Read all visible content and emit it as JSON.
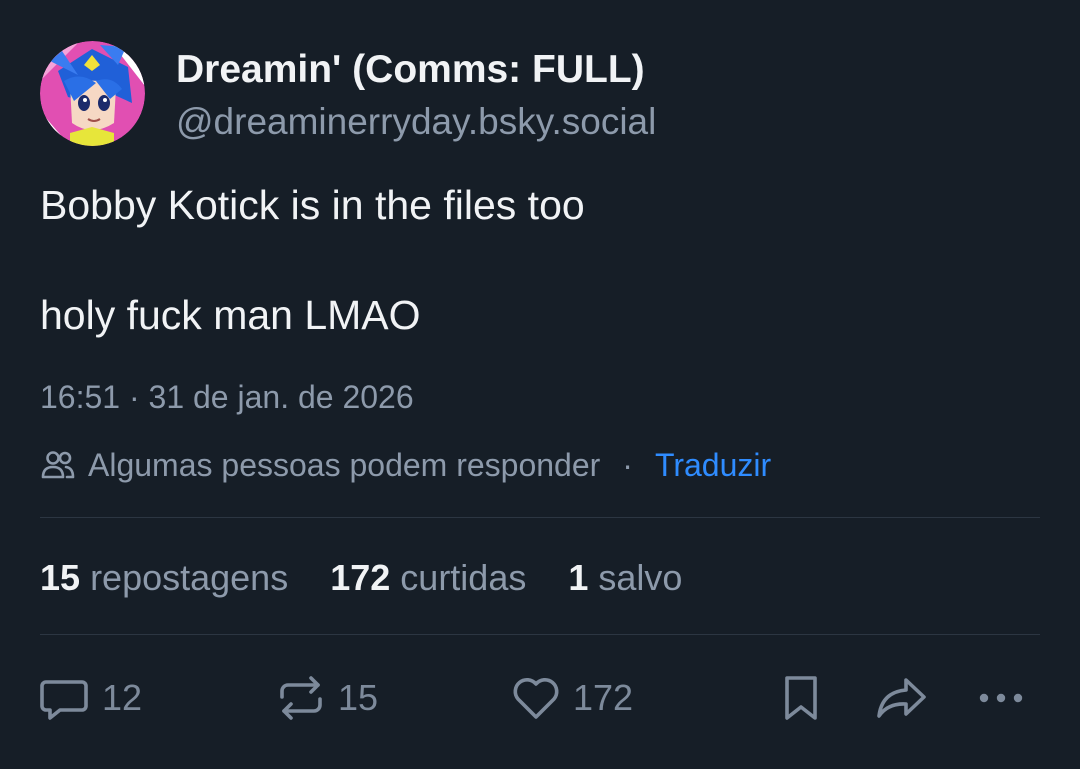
{
  "author": {
    "display_name": "Dreamin' (Comms: FULL)",
    "handle": "@dreaminerryday.bsky.social",
    "avatar_icon": "anime-character-avatar"
  },
  "post": {
    "line1": "Bobby Kotick is in the files too",
    "line2": "holy fuck man LMAO",
    "timestamp": "16:51 · 31 de jan. de 2026"
  },
  "reply_settings": {
    "icon": "people-icon",
    "text": "Algumas pessoas podem responder",
    "separator": "·",
    "translate_label": "Traduzir"
  },
  "stats": {
    "reposts": {
      "count": "15",
      "label": "repostagens"
    },
    "likes": {
      "count": "172",
      "label": "curtidas"
    },
    "saves": {
      "count": "1",
      "label": "salvo"
    }
  },
  "actions": {
    "reply": {
      "icon": "comment-icon",
      "count": "12"
    },
    "repost": {
      "icon": "repost-icon",
      "count": "15"
    },
    "like": {
      "icon": "heart-icon",
      "count": "172"
    },
    "bookmark": {
      "icon": "bookmark-icon"
    },
    "share": {
      "icon": "share-icon"
    },
    "more": {
      "icon": "more-icon"
    }
  },
  "colors": {
    "background": "#161e27",
    "primary_text": "#f1f3f5",
    "secondary_text": "#8d9aab",
    "link": "#2f8cff",
    "divider": "#2c3642"
  }
}
